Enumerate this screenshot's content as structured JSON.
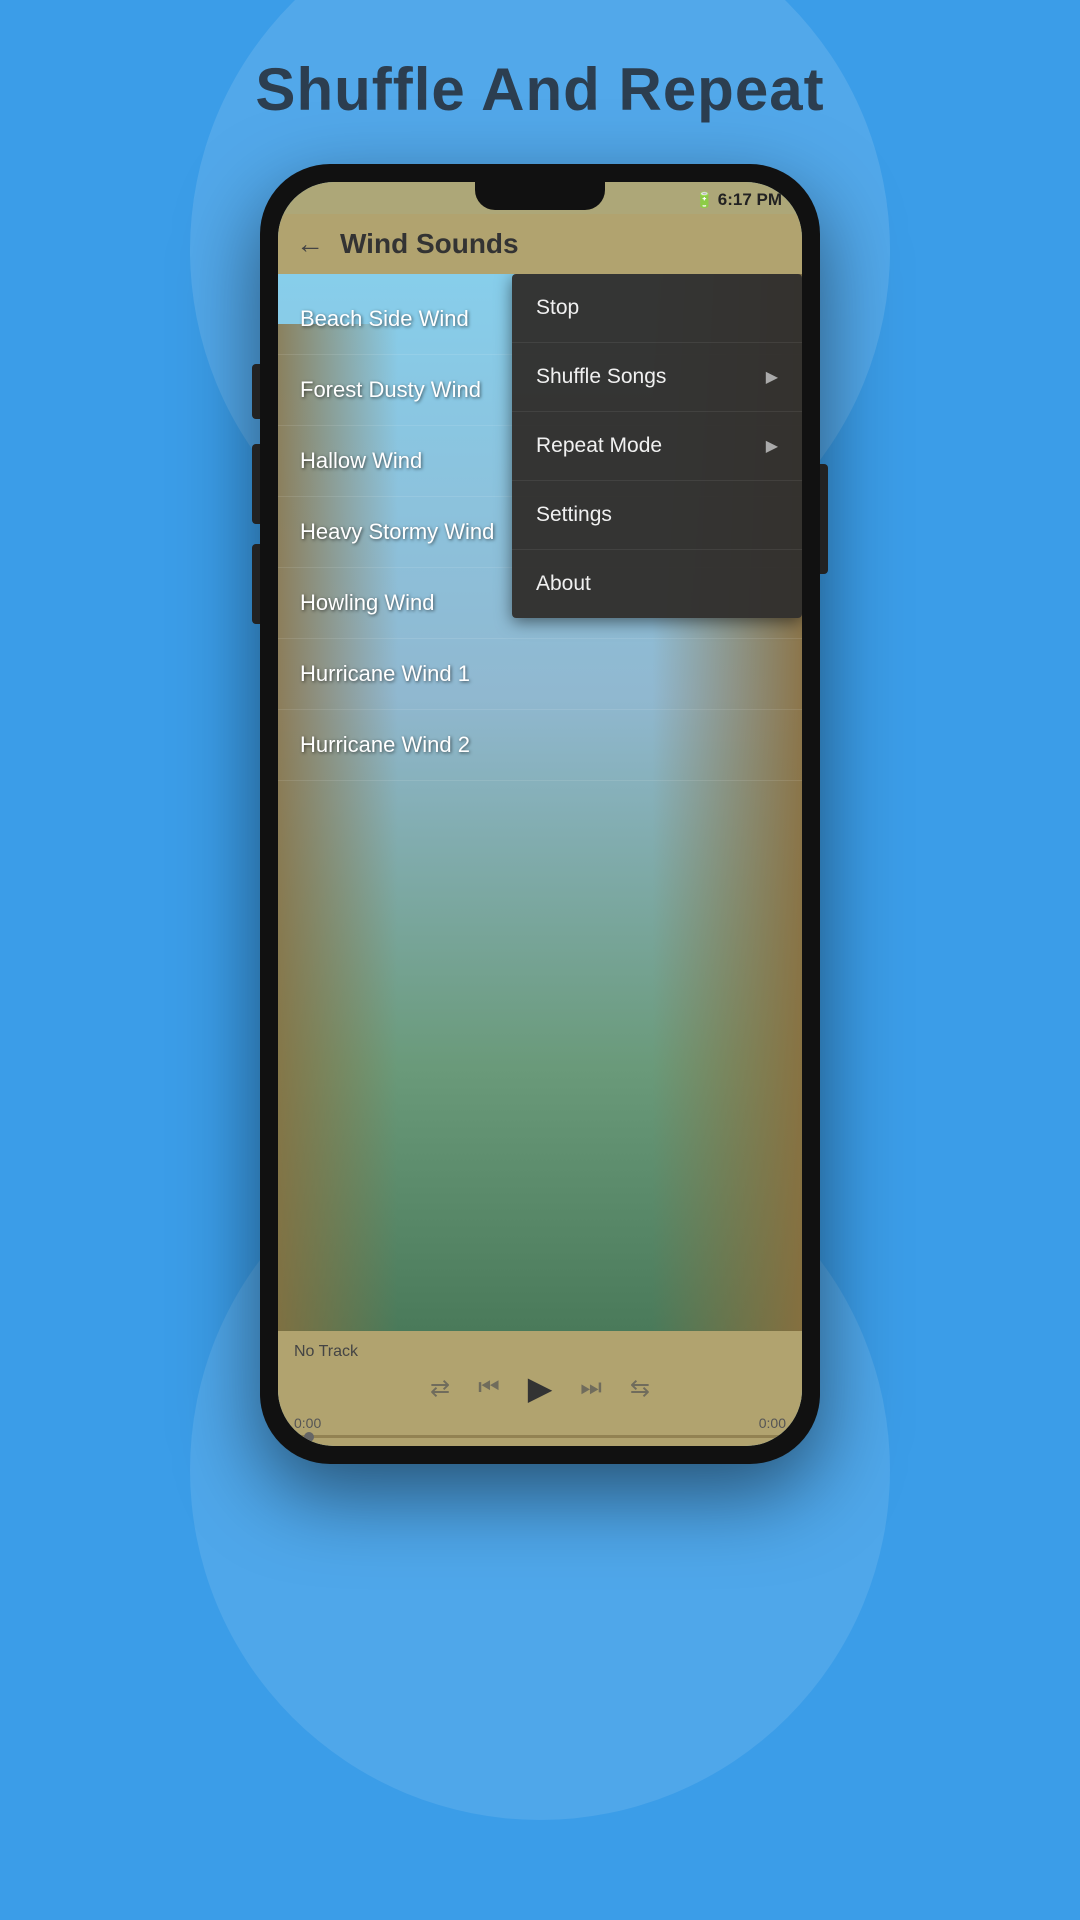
{
  "page": {
    "title": "Shuffle And Repeat",
    "background_color": "#3b9de8"
  },
  "phone": {
    "status_bar": {
      "time": "6:17 PM",
      "battery": "▮▮▮▮"
    },
    "top_bar": {
      "back_label": "←",
      "title": "Wind Sounds"
    },
    "song_list": {
      "items": [
        {
          "label": "Beach Side Wind"
        },
        {
          "label": "Forest Dusty Wind"
        },
        {
          "label": "Hallow Wind"
        },
        {
          "label": "Heavy Stormy Wind"
        },
        {
          "label": "Howling Wind"
        },
        {
          "label": "Hurricane Wind 1"
        },
        {
          "label": "Hurricane Wind 2"
        }
      ]
    },
    "dropdown_menu": {
      "items": [
        {
          "label": "Stop",
          "has_arrow": false
        },
        {
          "label": "Shuffle Songs",
          "has_arrow": true
        },
        {
          "label": "Repeat Mode",
          "has_arrow": true
        },
        {
          "label": "Settings",
          "has_arrow": false
        },
        {
          "label": "About",
          "has_arrow": false
        }
      ]
    },
    "player": {
      "no_track_label": "No Track",
      "time_start": "0:00",
      "time_end": "0:00",
      "controls": {
        "shuffle": "⇄",
        "prev": "⏮",
        "play": "▶",
        "next": "⏭",
        "repeat": "⇆"
      }
    }
  }
}
